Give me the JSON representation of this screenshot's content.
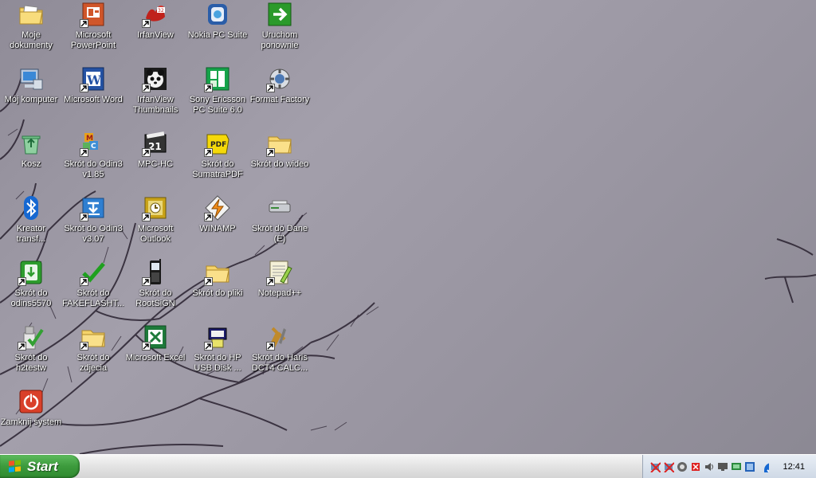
{
  "desktop": {
    "icons": [
      {
        "label": "Moje\ndokumenty",
        "icon": "folder-documents-icon"
      },
      {
        "label": "Microsoft\nPowerPoint",
        "icon": "powerpoint-icon"
      },
      {
        "label": "IrfanView",
        "icon": "irfanview-icon"
      },
      {
        "label": "Nokia PC Suite",
        "icon": "nokia-pc-suite-icon"
      },
      {
        "label": "Uruchom\nponownie",
        "icon": "restart-icon"
      },
      {
        "label": "Mój komputer",
        "icon": "my-computer-icon"
      },
      {
        "label": "Microsoft Word",
        "icon": "word-icon"
      },
      {
        "label": "IrfanView\nThumbnails",
        "icon": "irfanview-thumbnails-icon"
      },
      {
        "label": "Sony Ericsson\nPC Suite 6.0",
        "icon": "sony-ericsson-icon"
      },
      {
        "label": "Format Factory",
        "icon": "format-factory-icon"
      },
      {
        "label": "Kosz",
        "icon": "recycle-bin-icon"
      },
      {
        "label": "Skrót do Odin3\nv1.85",
        "icon": "odin3-icon"
      },
      {
        "label": "MPC-HC",
        "icon": "mpc-hc-icon"
      },
      {
        "label": "Skrót do\nSumatraPDF",
        "icon": "sumatra-pdf-icon"
      },
      {
        "label": "Skrót do wideo",
        "icon": "folder-icon"
      },
      {
        "label": "Kreator\ntransf...",
        "icon": "bluetooth-icon"
      },
      {
        "label": "Skrót do Odin3\nv3.07",
        "icon": "odin3-download-icon"
      },
      {
        "label": "Microsoft\nOutlook",
        "icon": "outlook-icon"
      },
      {
        "label": "WINAMP",
        "icon": "winamp-icon"
      },
      {
        "label": "Skrót do Dane\n(E)",
        "icon": "drive-icon"
      },
      {
        "label": "Skrót do\nodins5570",
        "icon": "odin-green-icon"
      },
      {
        "label": "Skrót do\nFAKEFLASHT...",
        "icon": "checkmark-icon"
      },
      {
        "label": "Skrót do\nRootSiGN",
        "icon": "phone-icon"
      },
      {
        "label": "Skrót do pliki",
        "icon": "folder-icon"
      },
      {
        "label": "Notepad++",
        "icon": "notepad-plus-icon"
      },
      {
        "label": "Skrót do\nh2testw",
        "icon": "h2testw-icon"
      },
      {
        "label": "Skrót do\nzdjecia",
        "icon": "folder-icon"
      },
      {
        "label": "Microsoft Excel",
        "icon": "excel-icon"
      },
      {
        "label": "Skrót do HP\nUSB Disk ...",
        "icon": "hp-usb-icon"
      },
      {
        "label": "Skrót do Haris\nDCT4 CALC...",
        "icon": "haris-calc-icon"
      },
      {
        "label": "Zamknij system",
        "icon": "shutdown-icon"
      }
    ]
  },
  "taskbar": {
    "start_label": "Start",
    "clock": "12:41",
    "tray_icons": [
      "network-disconnected-icon",
      "network-disconnected-icon",
      "shield-icon",
      "antivirus-icon",
      "volume-icon",
      "monitor-icon",
      "display-icon",
      "network-icon",
      "bluetooth-icon"
    ]
  }
}
